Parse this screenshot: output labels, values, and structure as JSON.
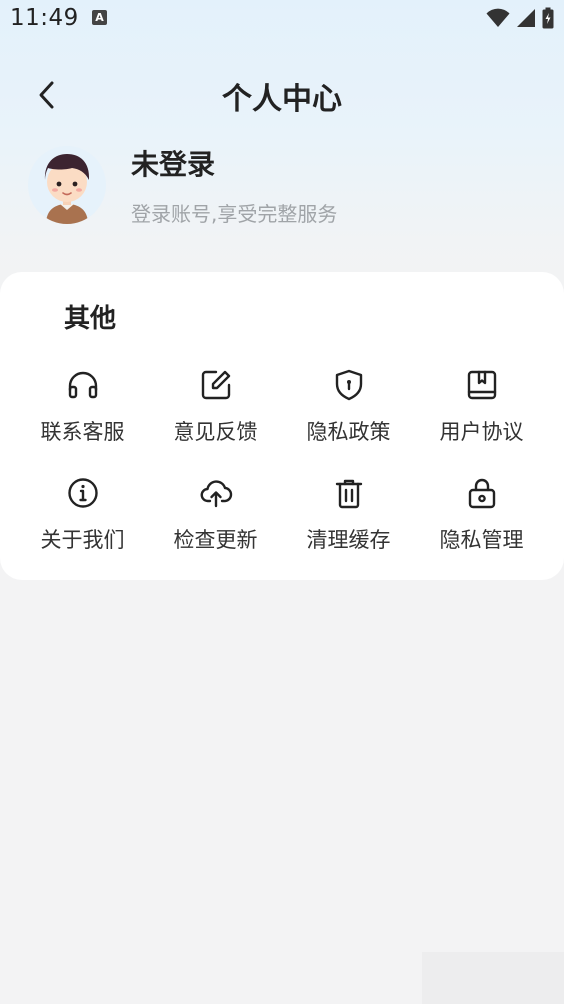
{
  "status_bar": {
    "time": "11:49",
    "notification_badge": "A"
  },
  "header": {
    "title": "个人中心",
    "back_icon": "chevron-left-icon"
  },
  "profile": {
    "name": "未登录",
    "subtitle": "登录账号,享受完整服务"
  },
  "section": {
    "title": "其他",
    "items": [
      {
        "label": "联系客服",
        "icon": "headphones-icon"
      },
      {
        "label": "意见反馈",
        "icon": "edit-icon"
      },
      {
        "label": "隐私政策",
        "icon": "shield-icon"
      },
      {
        "label": "用户协议",
        "icon": "book-icon"
      },
      {
        "label": "关于我们",
        "icon": "info-icon"
      },
      {
        "label": "检查更新",
        "icon": "cloud-upload-icon"
      },
      {
        "label": "清理缓存",
        "icon": "trash-icon"
      },
      {
        "label": "隐私管理",
        "icon": "lock-icon"
      }
    ]
  },
  "colors": {
    "text_primary": "#222222",
    "text_secondary": "#a0a4a8",
    "background": "#f3f3f4",
    "card": "#ffffff",
    "header_gradient": "#e3f1fb"
  }
}
